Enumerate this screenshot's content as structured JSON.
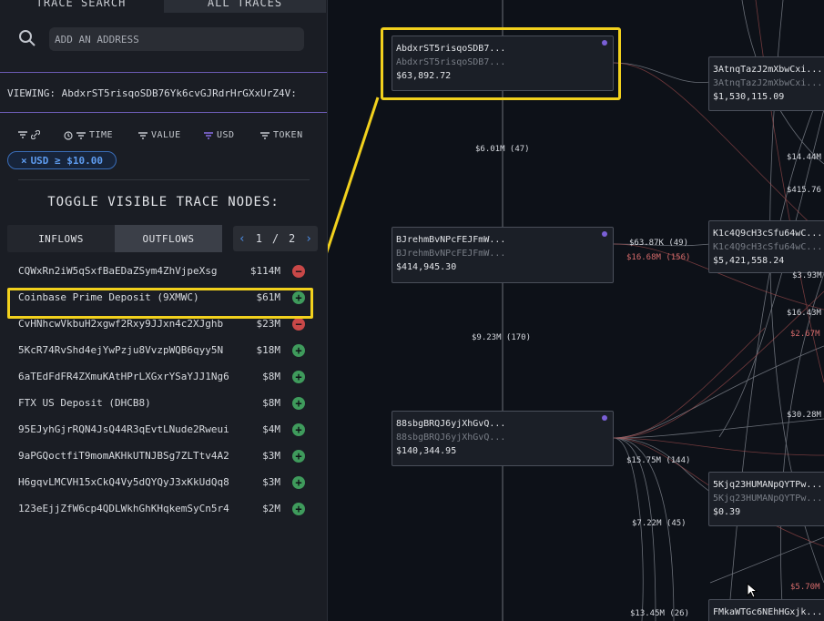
{
  "tabs": {
    "trace_search": "TRACE SEARCH",
    "all_traces": "ALL TRACES"
  },
  "search": {
    "placeholder": "ADD AN ADDRESS"
  },
  "viewing": "VIEWING: AbdxrST5risqoSDB76Yk6cvGJRdrHrGXxUrZ4V:",
  "filters": {
    "time": "TIME",
    "value": "VALUE",
    "usd": "USD",
    "token": "TOKEN"
  },
  "usd_chip": "USD ≥ $10.00",
  "toggle_title": "TOGGLE VISIBLE TRACE NODES:",
  "segments": {
    "inflows": "INFLOWS",
    "outflows": "OUTFLOWS"
  },
  "pager": {
    "current": "1",
    "sep": "/",
    "total": "2"
  },
  "rows": [
    {
      "addr": "CQWxRn2iW5qSxfBaEDaZSym4ZhVjpeXsg",
      "amount": "$114M",
      "state": "minus"
    },
    {
      "addr": "Coinbase Prime Deposit (9XMWC)",
      "amount": "$61M",
      "state": "plus"
    },
    {
      "addr": "CvHNhcwVkbuH2xgwf2Rxy9JJxn4c2XJghb",
      "amount": "$23M",
      "state": "minus"
    },
    {
      "addr": "5KcR74RvShd4ejYwPzju8VvzpWQB6qyy5N",
      "amount": "$18M",
      "state": "plus"
    },
    {
      "addr": "6aTEdFdFR4ZXmuKAtHPrLXGxrYSaYJJ1Ng6",
      "amount": "$8M",
      "state": "plus"
    },
    {
      "addr": "FTX US Deposit (DHCB8)",
      "amount": "$8M",
      "state": "plus"
    },
    {
      "addr": "95EJyhGjrRQN4JsQ44R3qEvtLNude2Rweui",
      "amount": "$4M",
      "state": "plus"
    },
    {
      "addr": "9aPGQoctfiT9momAKHkUTNJBSg7ZLTtv4A2",
      "amount": "$3M",
      "state": "plus"
    },
    {
      "addr": "H6gqvLMCVH15xCkQ4Vy5dQYQyJ3xKkUdQq8",
      "amount": "$3M",
      "state": "plus"
    },
    {
      "addr": "123eEjjZfW6cp4QDLWkhGhKHqkemSyCn5r4",
      "amount": "$2M",
      "state": "plus"
    }
  ],
  "nodes": [
    {
      "l1": "AbdxrST5risqoSDB7...",
      "l2": "AbdxrST5risqoSDB7...",
      "l3": "$63,892.72"
    },
    {
      "l1": "BJrehmBvNPcFEJFmW...",
      "l2": "BJrehmBvNPcFEJFmW...",
      "l3": "$414,945.30"
    },
    {
      "l1": "88sbgBRQJ6yjXhGvQ...",
      "l2": "88sbgBRQJ6yjXhGvQ...",
      "l3": "$140,344.95"
    },
    {
      "l1": "3AtnqTazJ2mXbwCxi...",
      "l2": "3AtnqTazJ2mXbwCxi...",
      "l3": "$1,530,115.09"
    },
    {
      "l1": "K1c4Q9cH3cSfu64wC...",
      "l2": "K1c4Q9cH3cSfu64wC...",
      "l3": "$5,421,558.24"
    },
    {
      "l1": "5Kjq23HUMANpQYTPw...",
      "l2": "5Kjq23HUMANpQYTPw...",
      "l3": "$0.39"
    },
    {
      "l1": "FMkaWTGc6NEhHGxjk...",
      "l2": "",
      "l3": ""
    }
  ],
  "edge_labels": [
    {
      "text": "$6.01M (47)",
      "color": "white"
    },
    {
      "text": "$9.23M (170)",
      "color": "white"
    },
    {
      "text": "$63.87K (49)",
      "color": "white"
    },
    {
      "text": "$16.68M (156)",
      "color": "red"
    },
    {
      "text": "$15.75M (144)",
      "color": "white"
    },
    {
      "text": "$7.22M (45)",
      "color": "white"
    },
    {
      "text": "$13.45M (26)",
      "color": "white"
    },
    {
      "text": "$14.44M",
      "color": "white"
    },
    {
      "text": "$415.76",
      "color": "white"
    },
    {
      "text": "$3.93M",
      "color": "white"
    },
    {
      "text": "$16.43M",
      "color": "white"
    },
    {
      "text": "$2.67M",
      "color": "red"
    },
    {
      "text": "$30.28M",
      "color": "white"
    },
    {
      "text": "$5.70M",
      "color": "red"
    }
  ],
  "colors": {
    "accent": "#7a5fd6",
    "highlight": "#f2d11d",
    "plus": "#3f9b5c",
    "minus": "#c94848",
    "link": "#4e8fe8"
  }
}
